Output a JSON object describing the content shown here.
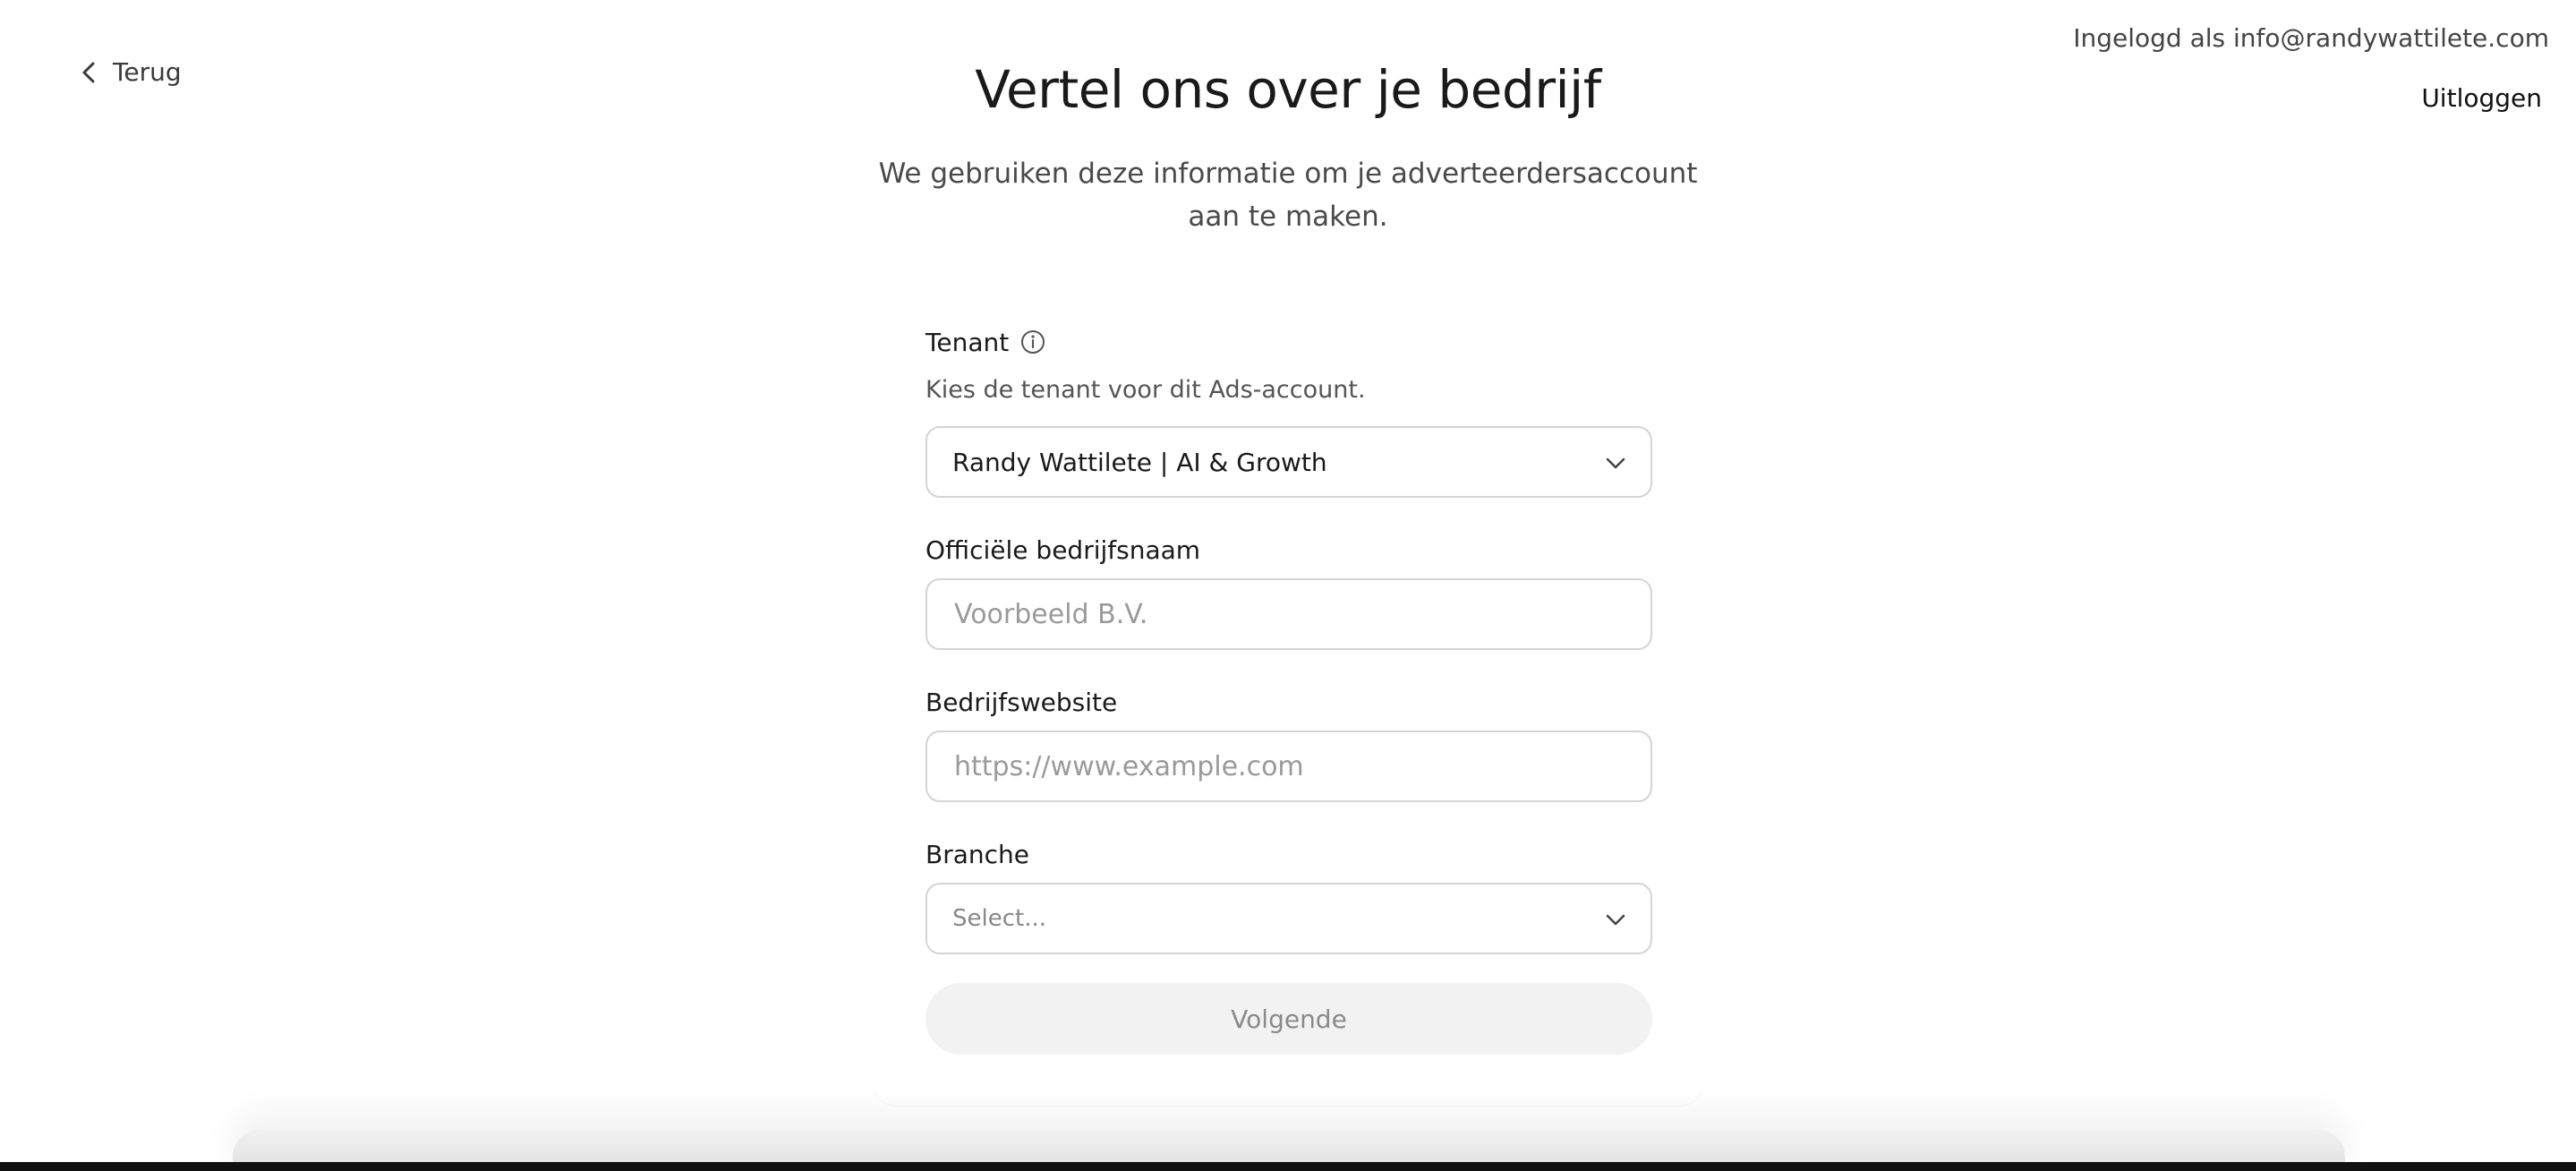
{
  "nav": {
    "back_label": "Terug"
  },
  "account": {
    "logged_in_text": "Ingelogd als info@randywattilete.com",
    "logout_label": "Uitloggen"
  },
  "header": {
    "title": "Vertel ons over je bedrijf",
    "subtitle": "We gebruiken deze informatie om je adverteerdersaccount aan te maken."
  },
  "form": {
    "tenant": {
      "label": "Tenant",
      "help": "Kies de tenant voor dit Ads-account.",
      "value": "Randy Wattilete | AI & Growth"
    },
    "company_name": {
      "label": "Officiële bedrijfsnaam",
      "placeholder": "Voorbeeld B.V.",
      "value": ""
    },
    "website": {
      "label": "Bedrijfswebsite",
      "placeholder": "https://www.example.com",
      "value": ""
    },
    "industry": {
      "label": "Branche",
      "placeholder": "Select..."
    },
    "submit_label": "Volgende"
  },
  "icons": {
    "back": "chevron-left-icon",
    "info": "info-icon",
    "dropdown": "chevron-down-icon"
  },
  "colors": {
    "text": "#1a1a1a",
    "muted": "#555555",
    "border": "#d4d4d4",
    "button_disabled_bg": "#f2f2f2",
    "button_disabled_text": "#8a8a8a"
  }
}
